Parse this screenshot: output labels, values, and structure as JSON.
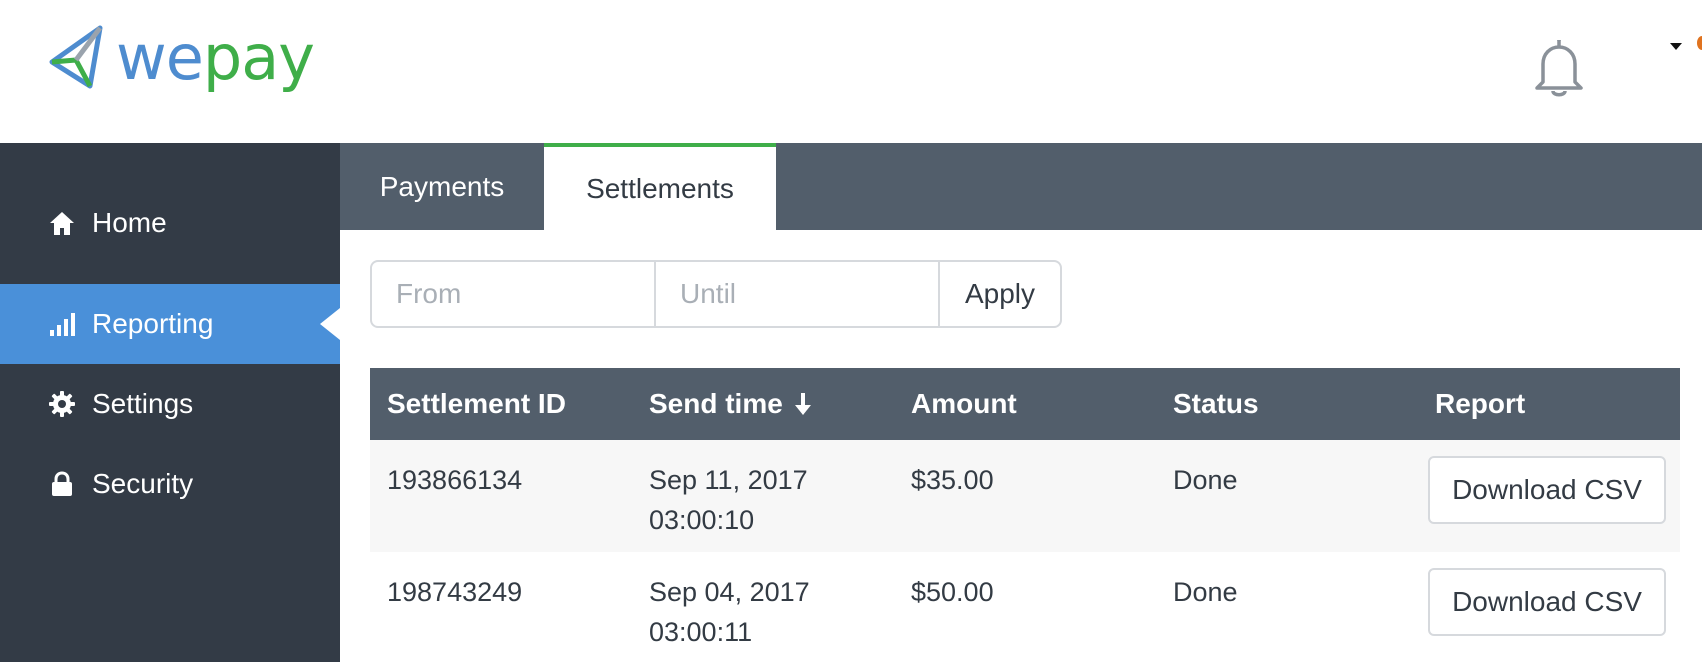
{
  "brand": {
    "logo_part1": "we",
    "logo_part2": "pay",
    "green": "#3fae49",
    "blue": "#4e8ccf"
  },
  "header": {
    "bell_icon": "bell-icon",
    "menu_icon": "caret-down-icon"
  },
  "sidebar": {
    "items": [
      {
        "label": "Home",
        "icon": "home-icon",
        "active": false
      },
      {
        "label": "Reporting",
        "icon": "bar-chart-icon",
        "active": true
      },
      {
        "label": "Settings",
        "icon": "gear-icon",
        "active": false
      },
      {
        "label": "Security",
        "icon": "lock-icon",
        "active": false
      }
    ]
  },
  "tabs": [
    {
      "label": "Payments",
      "active": false
    },
    {
      "label": "Settlements",
      "active": true
    }
  ],
  "filter": {
    "from_placeholder": "From",
    "until_placeholder": "Until",
    "apply_label": "Apply"
  },
  "table": {
    "columns": [
      "Settlement ID",
      "Send time",
      "Amount",
      "Status",
      "Report"
    ],
    "sort_column": "Send time",
    "rows": [
      {
        "id": "193866134",
        "date": "Sep 11, 2017",
        "time": "03:00:10",
        "amount": "$35.00",
        "status": "Done",
        "report": "Download CSV"
      },
      {
        "id": "198743249",
        "date": "Sep 04, 2017",
        "time": "03:00:11",
        "amount": "$50.00",
        "status": "Done",
        "report": "Download CSV"
      }
    ]
  },
  "colors": {
    "sidebar_bg": "#333b46",
    "active_blue": "#4a90d9",
    "header_gray": "#525e6b"
  }
}
